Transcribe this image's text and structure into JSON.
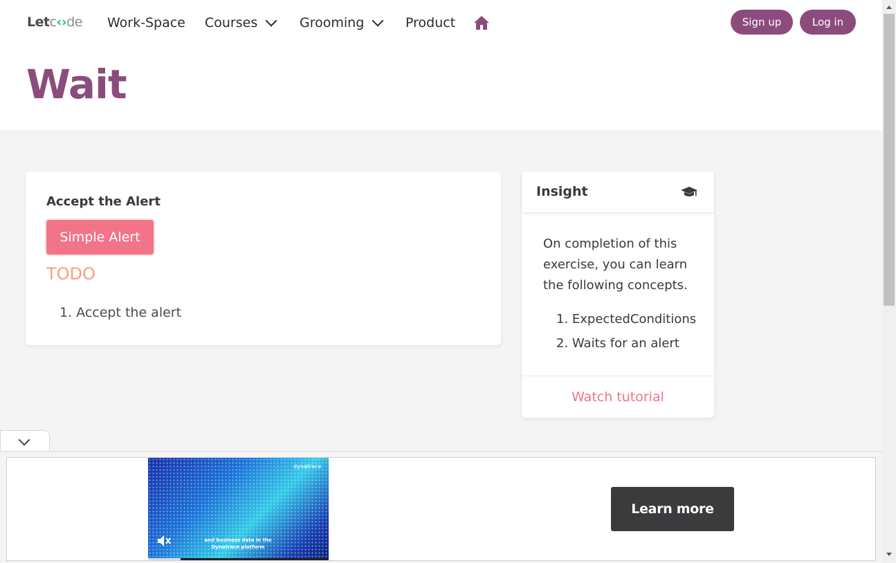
{
  "header": {
    "logo": {
      "part1": "Let",
      "bracket_left": "c",
      "bracket_mid": "o",
      "part2": "de"
    },
    "nav": [
      {
        "label": "Work-Space",
        "dropdown": false
      },
      {
        "label": "Courses",
        "dropdown": true
      },
      {
        "label": "Grooming",
        "dropdown": true
      },
      {
        "label": "Product",
        "dropdown": false
      }
    ],
    "home_icon": "home-icon",
    "signup_label": "Sign up",
    "login_label": "Log in",
    "accent_color": "#8b4c7c"
  },
  "page": {
    "title": "Wait"
  },
  "exercise": {
    "label": "Accept the Alert",
    "button_label": "Simple Alert",
    "button_color": "#f27489",
    "todo_heading": "TODO",
    "todo_items": [
      "1. Accept the alert"
    ]
  },
  "insight": {
    "title": "Insight",
    "icon": "graduation-cap-icon",
    "text": "On completion of this exercise, you can learn the following concepts.",
    "concepts": [
      "1. ExpectedConditions",
      "2. Waits for an alert"
    ],
    "footer_link": "Watch tutorial"
  },
  "ad": {
    "brand": "dynatrace",
    "caption": "and business data in the Dynatrace platform",
    "mute_icon": "muted-speaker-icon",
    "progress": 0.18,
    "cta_label": "Learn more",
    "collapse_icon": "chevron-down-icon"
  }
}
